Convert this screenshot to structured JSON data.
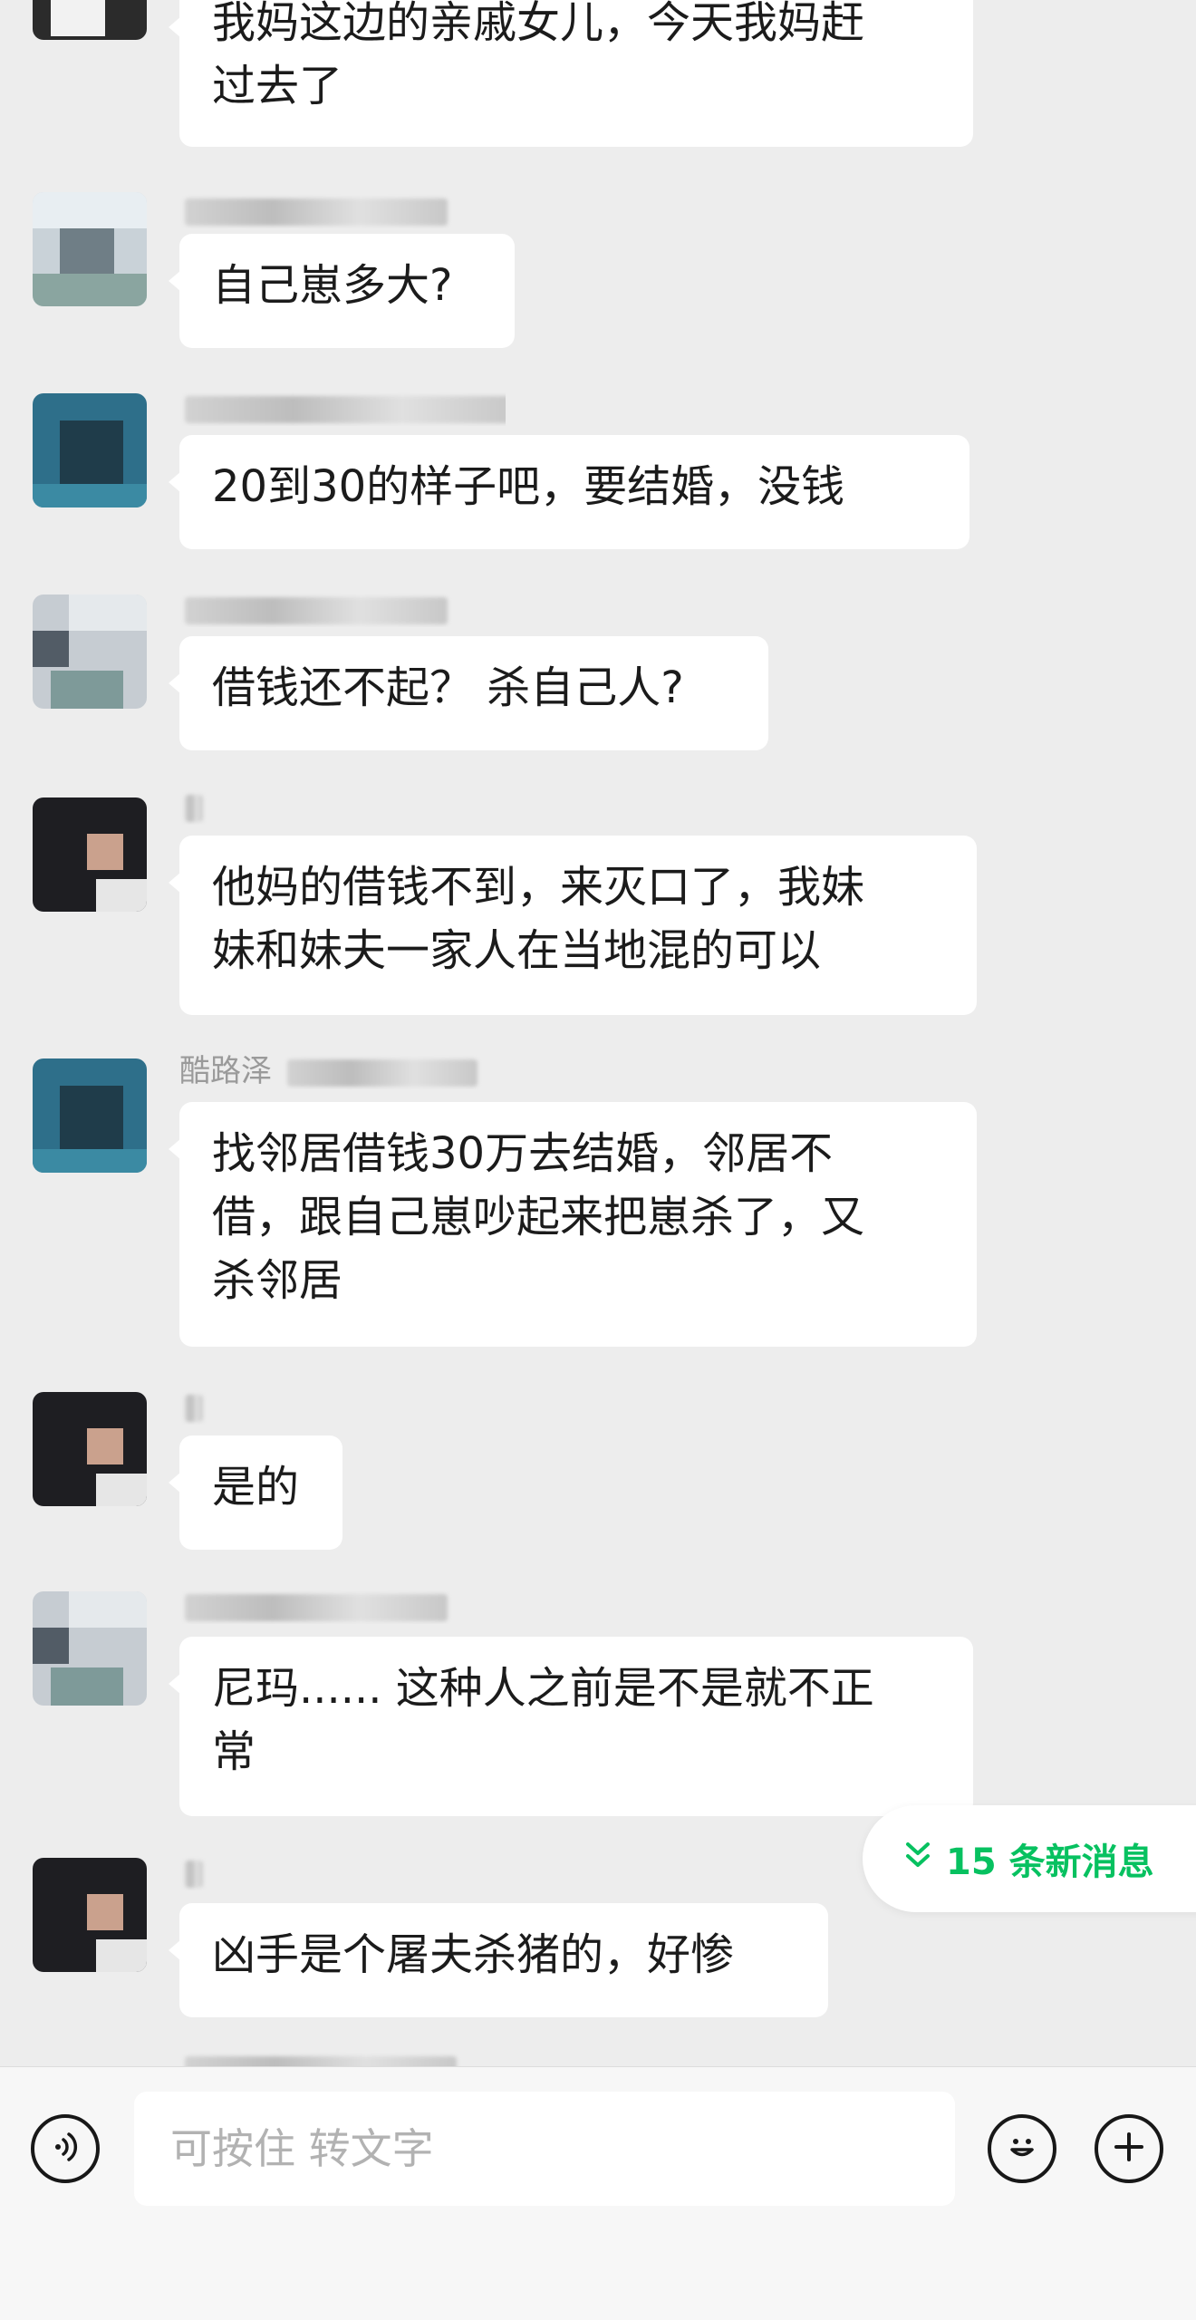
{
  "messages": [
    {
      "sender": "",
      "lines": [
        "我妈这边的亲戚女儿，今天我妈赶",
        "过去了"
      ]
    },
    {
      "sender": "",
      "lines": [
        "自己崽多大?"
      ]
    },
    {
      "sender": "",
      "lines": [
        "20到30的样子吧，要结婚，没钱"
      ]
    },
    {
      "sender": "",
      "lines": [
        "借钱还不起？ 杀自己人?"
      ]
    },
    {
      "sender": "",
      "lines": [
        "他妈的借钱不到，来灭口了，我妹",
        "妹和妹夫一家人在当地混的可以"
      ]
    },
    {
      "sender": "酷路泽",
      "lines": [
        "找邻居借钱30万去结婚，邻居不",
        "借，跟自己崽吵起来把崽杀了，又",
        "杀邻居"
      ]
    },
    {
      "sender": "",
      "lines": [
        "是的"
      ]
    },
    {
      "sender": "",
      "lines": [
        "尼玛...... 这种人之前是不是就不正",
        "常"
      ]
    },
    {
      "sender": "",
      "lines": [
        "凶手是个屠夫杀猪的，好惨"
      ]
    }
  ],
  "new_messages_label": "15 条新消息",
  "input": {
    "placeholder": "可按住 转文字"
  },
  "icons": {
    "voice": "voice-icon",
    "emoji": "emoji-icon",
    "add": "plus-icon",
    "new_messages": "double-chevron-down-icon"
  },
  "colors": {
    "accent": "#07c160",
    "background": "#ededed",
    "bubble": "#ffffff"
  }
}
